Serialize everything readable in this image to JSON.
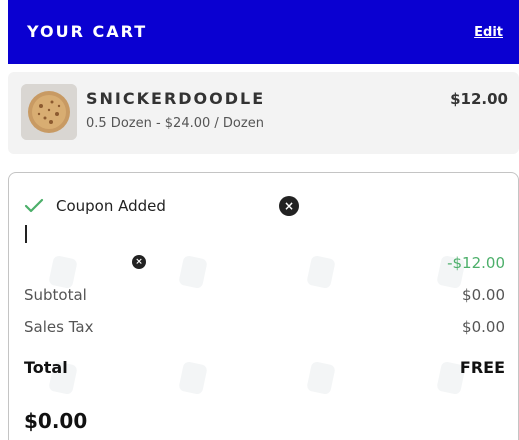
{
  "header": {
    "title": "YOUR CART",
    "edit_label": "Edit",
    "background_color": "#0a00d1"
  },
  "item": {
    "name": "SNICKERDOODLE",
    "detail": "0.5 Dozen - $24.00 / Dozen",
    "price": "$12.00",
    "image": "snickerdoodle-cookie"
  },
  "coupon": {
    "label": "Coupon Added",
    "status_icon": "check-icon",
    "remove_icon": "close-icon",
    "check_color": "#4caf6a"
  },
  "discount": {
    "value": "-$12.00",
    "color": "#4caf6a"
  },
  "summary": {
    "rows": [
      {
        "label": "Subtotal",
        "value": "$0.00"
      },
      {
        "label": "Sales Tax",
        "value": "$0.00"
      }
    ],
    "total_label": "Total",
    "total_value": "FREE",
    "grand_total": "$0.00"
  }
}
